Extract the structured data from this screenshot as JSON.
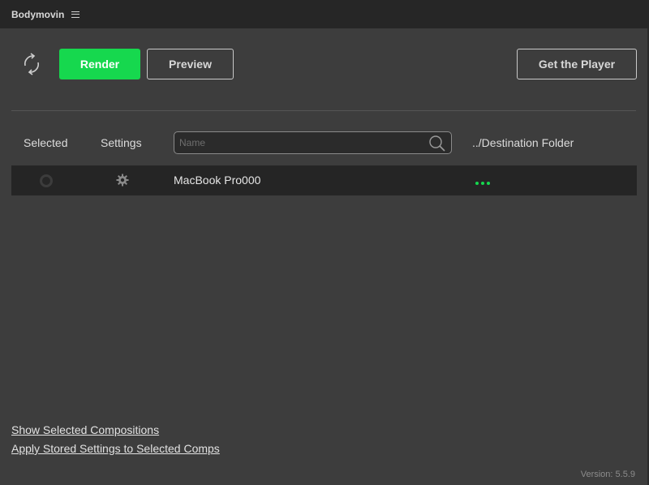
{
  "titlebar": {
    "title": "Bodymovin",
    "menu_icon": "hamburger-icon"
  },
  "toolbar": {
    "refresh_icon": "refresh-icon",
    "render_label": "Render",
    "preview_label": "Preview",
    "player_label": "Get the Player"
  },
  "table": {
    "headers": {
      "selected": "Selected",
      "settings": "Settings",
      "destination": "../Destination Folder"
    },
    "search": {
      "placeholder": "Name",
      "value": "",
      "icon": "search-icon"
    },
    "rows": [
      {
        "selected": false,
        "settings_icon": "gear-icon",
        "name": "MacBook Pro000",
        "destination_icon": "more-dots-icon"
      }
    ]
  },
  "footer": {
    "show_selected_label": "Show Selected Compositions",
    "apply_settings_label": "Apply Stored Settings to Selected Comps",
    "version": "Version: 5.5.9"
  },
  "colors": {
    "accent": "#16d84e",
    "background": "#3d3d3d",
    "titlebar": "#262626",
    "row": "#252525"
  }
}
